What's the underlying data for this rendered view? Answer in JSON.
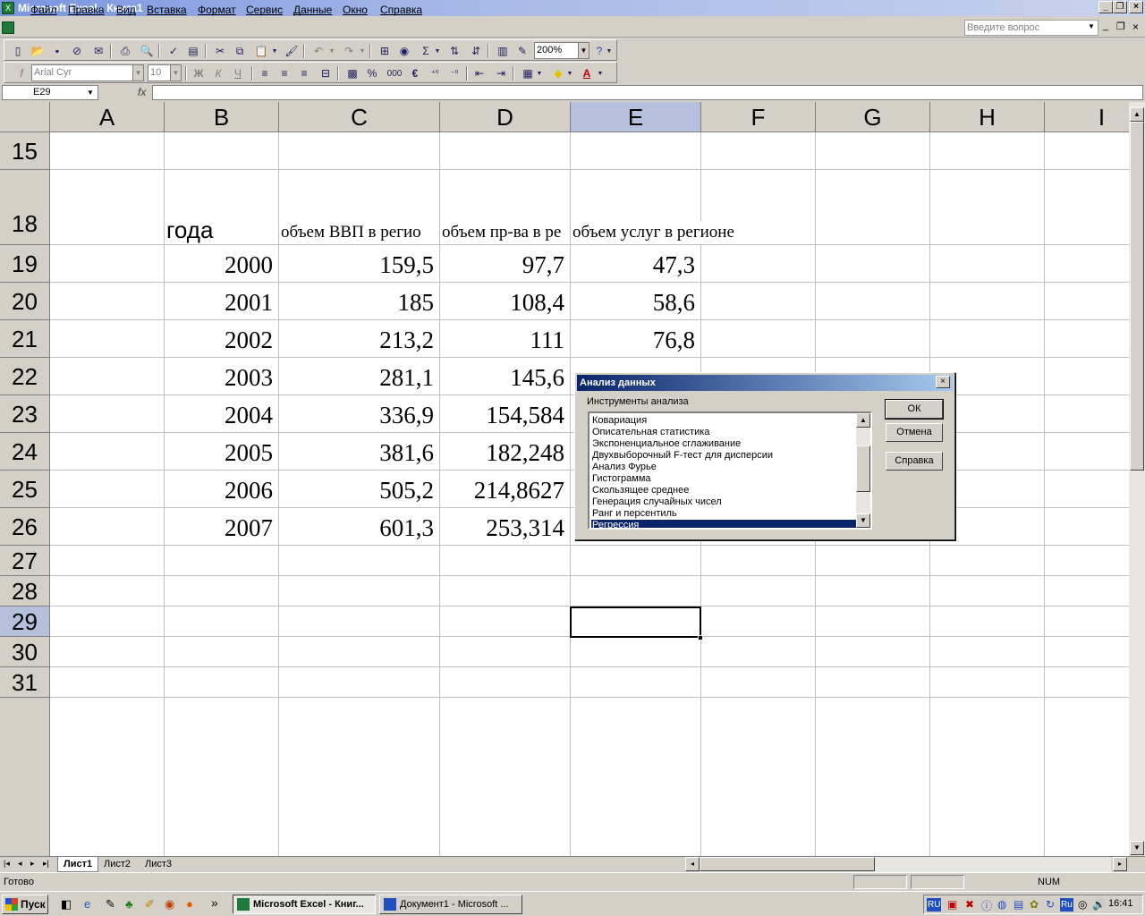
{
  "window": {
    "title": "Microsoft Excel - Книга1"
  },
  "menu": [
    "Файл",
    "Правка",
    "Вид",
    "Вставка",
    "Формат",
    "Сервис",
    "Данные",
    "Окно",
    "Справка"
  ],
  "help_box": {
    "placeholder": "Введите вопрос"
  },
  "toolbar": {
    "zoom": "200%",
    "font_name": "Arial Cyr",
    "font_size": "10",
    "bold": "Ж",
    "italic": "К",
    "underline": "Ч",
    "percent": "%",
    "thousands": "000",
    "euro": "€",
    "fx": "fx"
  },
  "formula_bar": {
    "name_box": "E29"
  },
  "grid": {
    "columns": [
      "A",
      "B",
      "C",
      "D",
      "E",
      "F",
      "G",
      "H",
      "I"
    ],
    "rows": [
      "15",
      "18",
      "19",
      "20",
      "21",
      "22",
      "23",
      "24",
      "25",
      "26",
      "27",
      "28",
      "29",
      "30",
      "31"
    ],
    "header_row": {
      "b": "года",
      "c": "объем ВВП в регио",
      "d": "объем пр-ва в ре",
      "e": "объем услуг в регионе"
    },
    "data": [
      {
        "year": "2000",
        "gdp": "159,5",
        "prod": "97,7",
        "serv": "47,3"
      },
      {
        "year": "2001",
        "gdp": "185",
        "prod": "108,4",
        "serv": "58,6"
      },
      {
        "year": "2002",
        "gdp": "213,2",
        "prod": "111",
        "serv": "76,8"
      },
      {
        "year": "2003",
        "gdp": "281,1",
        "prod": "145,6",
        "serv": ""
      },
      {
        "year": "2004",
        "gdp": "336,9",
        "prod": "154,584",
        "serv": ""
      },
      {
        "year": "2005",
        "gdp": "381,6",
        "prod": "182,248",
        "serv": ""
      },
      {
        "year": "2006",
        "gdp": "505,2",
        "prod": "214,8627",
        "serv": ""
      },
      {
        "year": "2007",
        "gdp": "601,3",
        "prod": "253,314",
        "serv": ""
      }
    ]
  },
  "sheets": [
    "Лист1",
    "Лист2",
    "Лист3"
  ],
  "status": {
    "ready": "Готово",
    "num": "NUM"
  },
  "taskbar": {
    "start": "Пуск",
    "tasks": [
      "Microsoft Excel - Книг...",
      "Документ1 - Microsoft ..."
    ],
    "lang1": "RU",
    "lang2": "Ru",
    "clock": "16:41"
  },
  "dialog": {
    "title": "Анализ данных",
    "label": "Инструменты анализа",
    "items": [
      "Ковариация",
      "Описательная статистика",
      "Экспоненциальное сглаживание",
      "Двухвыборочный F-тест для дисперсии",
      "Анализ Фурье",
      "Гистограмма",
      "Скользящее среднее",
      "Генерация случайных чисел",
      "Ранг и персентиль",
      "Регрессия"
    ],
    "ok": "ОК",
    "cancel": "Отмена",
    "help": "Справка"
  },
  "colors": {
    "selection": "#0a246a",
    "header_selected": "#b4c0dc"
  }
}
